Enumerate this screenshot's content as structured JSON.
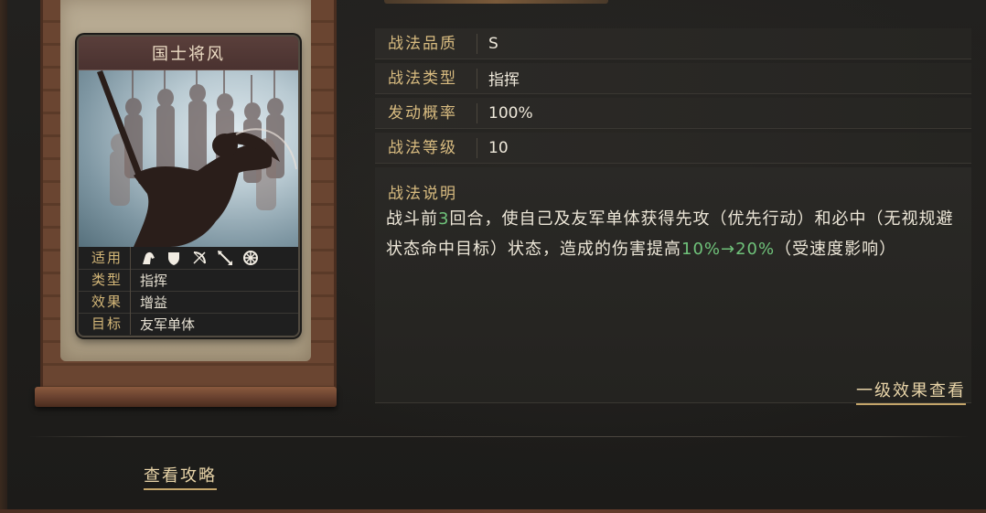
{
  "card": {
    "name": "国士将风",
    "rows": [
      {
        "label": "适用",
        "value": ""
      },
      {
        "label": "类型",
        "value": "指挥"
      },
      {
        "label": "效果",
        "value": "增益"
      },
      {
        "label": "目标",
        "value": "友军单体"
      }
    ],
    "unit_icons": [
      "cavalry-icon",
      "shield-icon",
      "bow-icon",
      "spear-icon",
      "wheel-icon"
    ]
  },
  "attributes": [
    {
      "label": "战法品质",
      "value": "S"
    },
    {
      "label": "战法类型",
      "value": "指挥"
    },
    {
      "label": "发动概率",
      "value": "100%"
    },
    {
      "label": "战法等级",
      "value": "10"
    }
  ],
  "description": {
    "title": "战法说明",
    "segments": [
      {
        "text": "战斗前",
        "highlight": false
      },
      {
        "text": "3",
        "highlight": true
      },
      {
        "text": "回合，使自己及友军单体获得先攻（优先行动）和必中（无视规避状态命中目标）状态，造成的伤害提高",
        "highlight": false
      },
      {
        "text": "10%→20%",
        "highlight": true
      },
      {
        "text": "（受速度影响）",
        "highlight": false
      }
    ],
    "highlight_color": "#6fc27a"
  },
  "links": {
    "level1_effect": "一级效果查看",
    "guide": "查看攻略"
  }
}
